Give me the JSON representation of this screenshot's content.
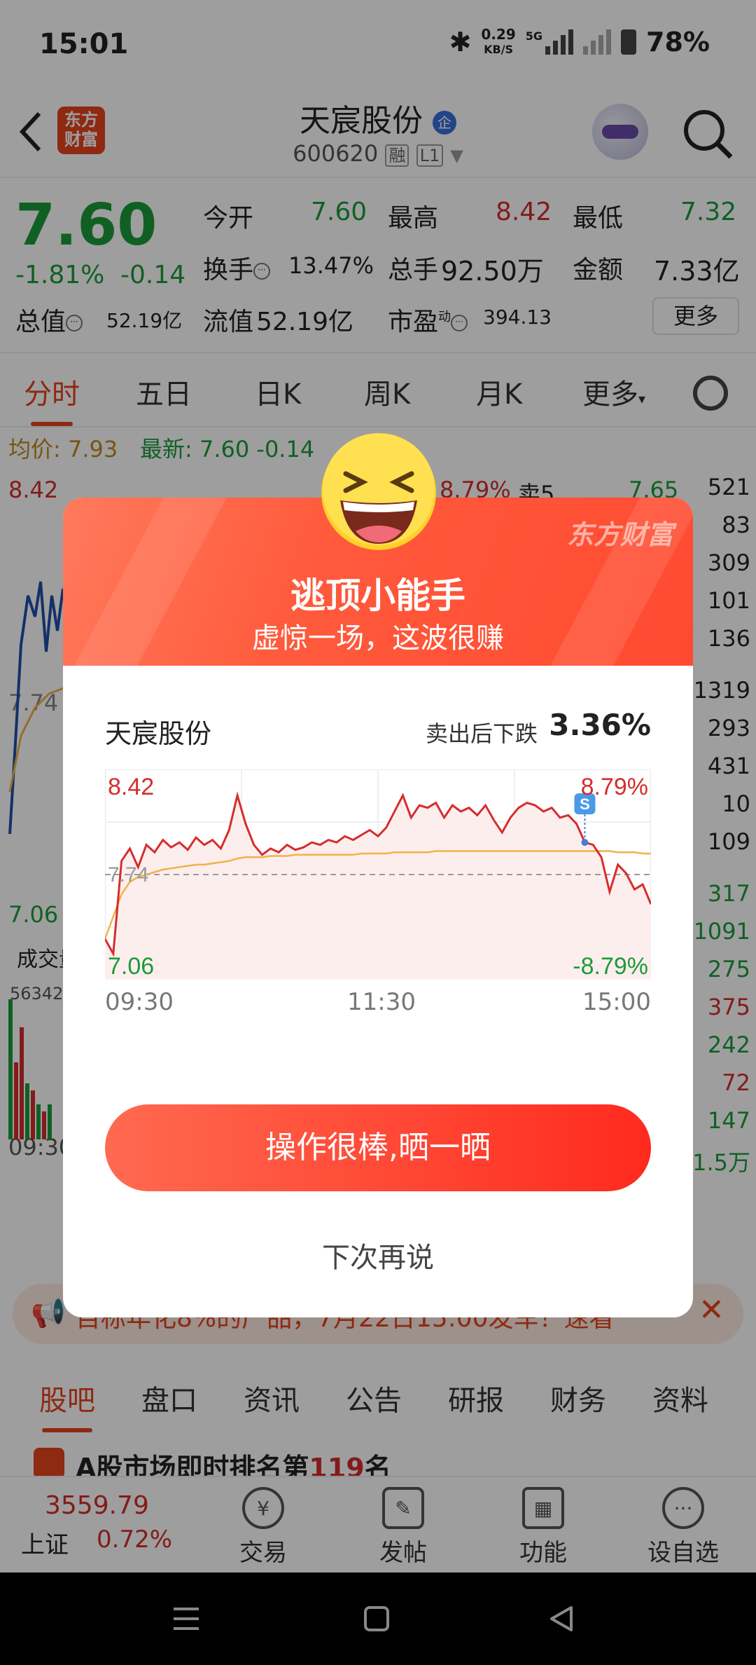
{
  "status_bar": {
    "time": "15:01",
    "net_speed": "0.29",
    "net_unit": "KB/S",
    "network": "5G",
    "battery": "78%"
  },
  "header": {
    "back_icon": "chevron-left-icon",
    "logo_text_1": "东方",
    "logo_text_2": "财富",
    "stock_name": "天宸股份",
    "badge": "企",
    "stock_code": "600620",
    "tag_margin": "融",
    "tag_level": "L1",
    "search_icon": "search-icon"
  },
  "quote": {
    "price": "7.60",
    "change_pct": "-1.81%",
    "change": "-0.14",
    "open_label": "今开",
    "open": "7.60",
    "high_label": "最高",
    "high": "8.42",
    "low_label": "最低",
    "low": "7.32",
    "turnover_label": "换手",
    "turnover": "13.47%",
    "volume_label": "总手",
    "volume": "92.50万",
    "amount_label": "金额",
    "amount": "7.33亿",
    "mcap_label": "总值",
    "mcap": "52.19亿",
    "float_label": "流值",
    "float_mcap": "52.19亿",
    "pe_label": "市盈",
    "pe_sup": "动",
    "pe": "394.13",
    "more": "更多"
  },
  "chart_tabs": [
    "分时",
    "五日",
    "日K",
    "周K",
    "月K",
    "更多"
  ],
  "behind": {
    "avg_label": "均价:",
    "avg": "7.93",
    "latest_label": "最新:",
    "latest": "7.60",
    "latest_chg": "-0.14",
    "top_price": "8.42",
    "mid_price": "7.74",
    "low_price": "7.06",
    "top_pct": "8.79%",
    "sell5": "卖5",
    "sell5_price": "7.65",
    "vol_label": "成交量",
    "vol_value": "56342",
    "time_start": "09:30",
    "order_numbers": [
      "521",
      "83",
      "309",
      "101",
      "136",
      "1319",
      "293",
      "431",
      "10",
      "109",
      "317",
      "1091",
      "275",
      "375",
      "242",
      "72",
      "147",
      "1.5万"
    ]
  },
  "notice": {
    "text": "目标年化8%的产品，7月22日15:00发车！速看"
  },
  "bottom_tabs": [
    "股吧",
    "盘口",
    "资讯",
    "公告",
    "研报",
    "财务",
    "资料"
  ],
  "news": {
    "text": "A股市场即时排名第",
    "rank": "119",
    "suffix": "名"
  },
  "bottom_nav": {
    "index_value": "3559.79",
    "index_name": "上证",
    "index_pct": "0.72%",
    "items": [
      "交易",
      "发帖",
      "功能",
      "设自选"
    ]
  },
  "modal": {
    "brand": "东方财富",
    "title": "逃顶小能手",
    "subtitle": "虚惊一场，这波很赚",
    "stock": "天宸股份",
    "drop_label": "卖出后下跌",
    "drop_value": "3.36%",
    "marker": "S",
    "button": "操作很棒,晒一晒",
    "later": "下次再说"
  },
  "chart_data": {
    "type": "line",
    "title": "",
    "x_ticks": [
      "09:30",
      "11:30",
      "15:00"
    ],
    "y_left_ticks": [
      "8.42",
      "7.74",
      "7.06"
    ],
    "y_right_ticks": [
      "8.79%",
      "-8.79%"
    ],
    "ylim": [
      7.06,
      8.42
    ],
    "baseline": 7.74,
    "series": [
      {
        "values": [
          7.22,
          7.1,
          7.85,
          7.95,
          7.8,
          7.98,
          7.92,
          8.02,
          7.96,
          8.0,
          7.94,
          8.04,
          7.98,
          8.02,
          7.95,
          8.1,
          8.38,
          8.15,
          7.98,
          7.9,
          7.95,
          7.92,
          7.98,
          7.94,
          7.96,
          8.0,
          7.98,
          8.02,
          8.0,
          8.05,
          8.02,
          8.06,
          8.1,
          8.05,
          8.12,
          8.25,
          8.38,
          8.2,
          8.3,
          8.28,
          8.32,
          8.2,
          8.3,
          8.25,
          8.28,
          8.22,
          8.3,
          8.18,
          8.08,
          8.2,
          8.28,
          8.32,
          8.3,
          8.25,
          8.28,
          8.2,
          8.22,
          8.15,
          8.0,
          7.98,
          7.88,
          7.6,
          7.82,
          7.75,
          7.62,
          7.66,
          7.5
        ]
      },
      {
        "values": [
          7.22,
          7.4,
          7.58,
          7.68,
          7.72,
          7.74,
          7.76,
          7.78,
          7.79,
          7.8,
          7.81,
          7.82,
          7.82,
          7.83,
          7.84,
          7.85,
          7.87,
          7.88,
          7.88,
          7.88,
          7.89,
          7.89,
          7.89,
          7.9,
          7.9,
          7.9,
          7.9,
          7.9,
          7.9,
          7.9,
          7.9,
          7.91,
          7.91,
          7.91,
          7.91,
          7.92,
          7.92,
          7.92,
          7.92,
          7.92,
          7.93,
          7.93,
          7.93,
          7.93,
          7.93,
          7.93,
          7.93,
          7.93,
          7.93,
          7.93,
          7.93,
          7.93,
          7.93,
          7.93,
          7.93,
          7.93,
          7.93,
          7.93,
          7.93,
          7.93,
          7.93,
          7.93,
          7.92,
          7.92,
          7.92,
          7.91,
          7.91
        ]
      }
    ],
    "sell_point_index": 58,
    "colors": {
      "price": "#d62d2d",
      "avg": "#f0b24a",
      "fill": "#fdeeee"
    },
    "grid": true
  },
  "colors": {
    "up": "#d62d2d",
    "down": "#1a9c3a",
    "accent": "#e6431d"
  }
}
